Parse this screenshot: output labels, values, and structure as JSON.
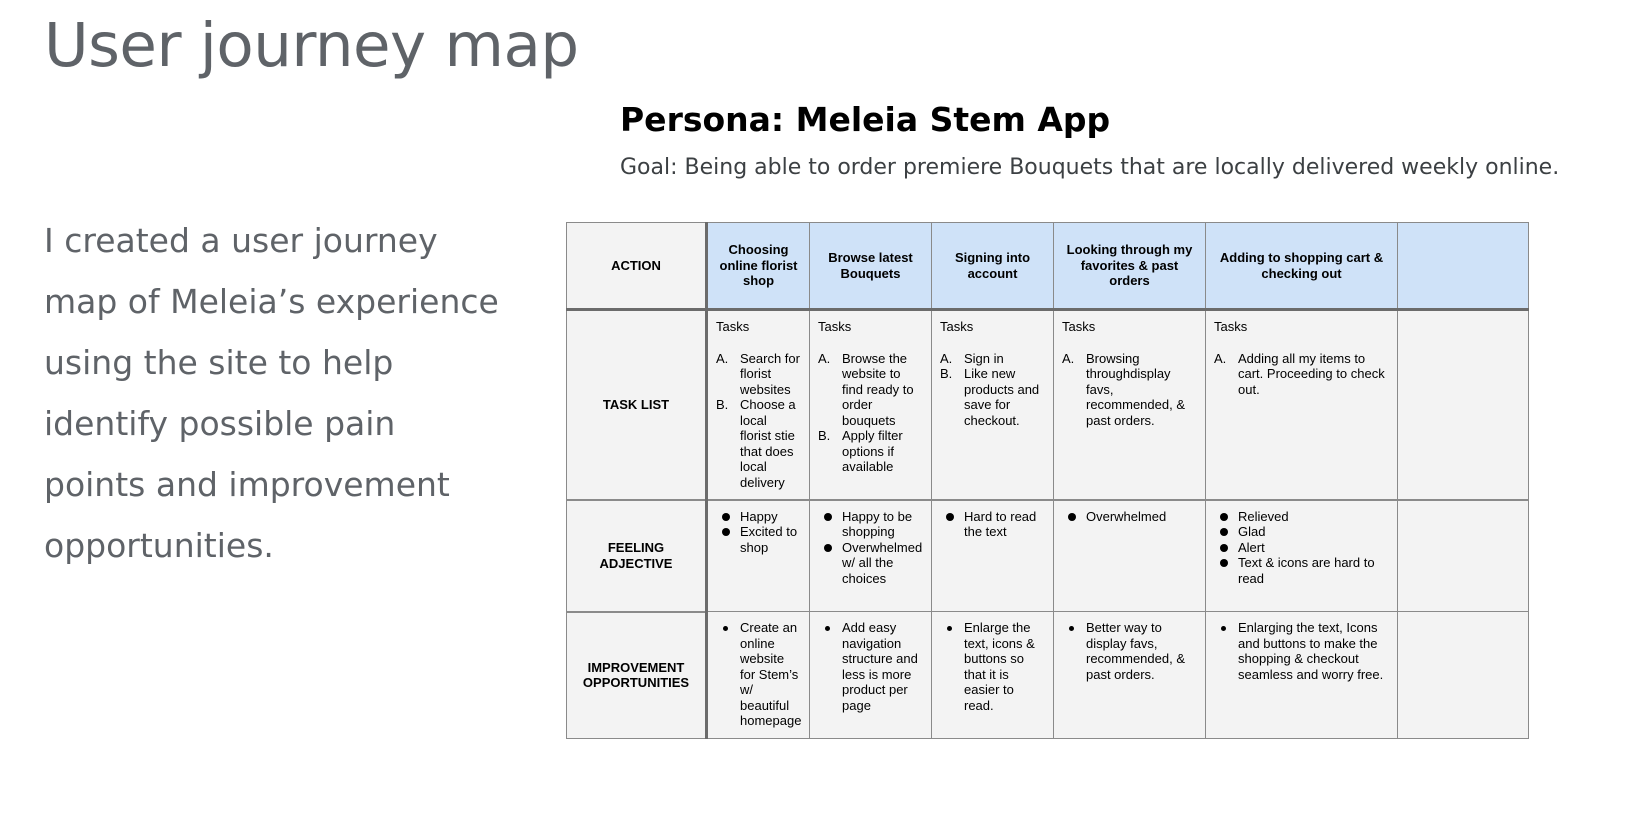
{
  "slide": {
    "title": "User journey map",
    "intro": "I created a user journey map of Meleia’s experience using the site to help identify possible pain points and improvement opportunities."
  },
  "persona": {
    "title": "Persona: Meleia Stem App",
    "goal": "Goal: Being able to order premiere Bouquets that are locally delivered weekly online."
  },
  "table": {
    "row_labels": {
      "action": "ACTION",
      "task_list": "TASK LIST",
      "feeling": [
        "FEELING",
        "ADJECTIVE"
      ],
      "improvement": [
        "IMPROVEMENT",
        "OPPORTUNITIES"
      ]
    },
    "tasks_label": "Tasks",
    "columns": [
      {
        "action": "Choosing online  florist shop",
        "tasks": [
          {
            "marker": "A.",
            "text": "Search for florist websites"
          },
          {
            "marker": "B.",
            "text": "Choose a local florist stie that does local delivery"
          }
        ],
        "feelings": [
          "Happy",
          "Excited to shop"
        ],
        "improvements": [
          "Create an online website for Stem’s w/ beautiful homepage"
        ]
      },
      {
        "action": "Browse latest Bouquets",
        "tasks": [
          {
            "marker": "A.",
            "text": "Browse the website to find ready to order bouquets"
          },
          {
            "marker": "B.",
            "text": "Apply filter options if available"
          }
        ],
        "feelings": [
          "Happy to be shopping",
          "Overwhelmed w/ all the choices"
        ],
        "improvements": [
          "Add easy navigation structure and less is more product per page"
        ]
      },
      {
        "action": "Signing into account",
        "tasks": [
          {
            "marker": "A.",
            "text": "Sign in"
          },
          {
            "marker": "B.",
            "text": "Like new products and save for checkout."
          }
        ],
        "feelings": [
          "Hard to read the text"
        ],
        "improvements": [
          "Enlarge the text, icons & buttons so that it is easier to read."
        ]
      },
      {
        "action": "Looking through my favorites & past orders",
        "tasks": [
          {
            "marker": "A.",
            "text": "Browsing throughdisplay favs, recommended, & past orders."
          }
        ],
        "feelings": [
          "Overwhelmed"
        ],
        "improvements": [
          "Better way to display favs, recommended, & past orders."
        ]
      },
      {
        "action": "Adding to shopping cart & checking out",
        "tasks": [
          {
            "marker": "A.",
            "text": "Adding all my items to cart. Proceeding to check out."
          }
        ],
        "feelings": [
          "Relieved",
          "Glad",
          "Alert",
          "Text & icons are hard to read"
        ],
        "improvements": [
          "Enlarging the text, Icons and buttons to make the shopping & checkout seamless and worry free."
        ]
      }
    ]
  }
}
